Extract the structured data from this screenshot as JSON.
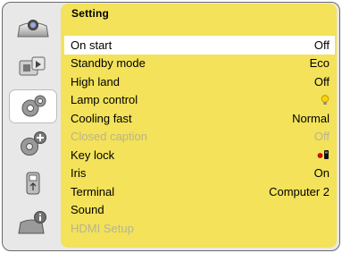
{
  "panel": {
    "title": "Setting"
  },
  "sidebar": {
    "items": [
      {
        "icon": "projector-icon"
      },
      {
        "icon": "image-adjust-icon"
      },
      {
        "icon": "setting-gear-icon",
        "active": true
      },
      {
        "icon": "expand-gears-icon"
      },
      {
        "icon": "usb-icon"
      },
      {
        "icon": "info-icon"
      }
    ]
  },
  "menu": {
    "rows": [
      {
        "label": "On start",
        "value": "Off",
        "selected": true
      },
      {
        "label": "Standby mode",
        "value": "Eco"
      },
      {
        "label": "High land",
        "value": "Off"
      },
      {
        "label": "Lamp control",
        "value": "",
        "icon": "lamp-bulb-icon"
      },
      {
        "label": "Cooling fast",
        "value": "Normal"
      },
      {
        "label": "Closed caption",
        "value": "Off",
        "disabled": true
      },
      {
        "label": "Key lock",
        "value": "",
        "icon": "key-lock-remote-icon"
      },
      {
        "label": "Iris",
        "value": "On"
      },
      {
        "label": "Terminal",
        "value": "Computer 2"
      },
      {
        "label": "Sound",
        "value": ""
      },
      {
        "label": "HDMI Setup",
        "value": "",
        "disabled": true
      }
    ]
  },
  "colors": {
    "panel": "#f3e25a",
    "selected_row": "#ffffff",
    "disabled_text": "#b9b391"
  }
}
